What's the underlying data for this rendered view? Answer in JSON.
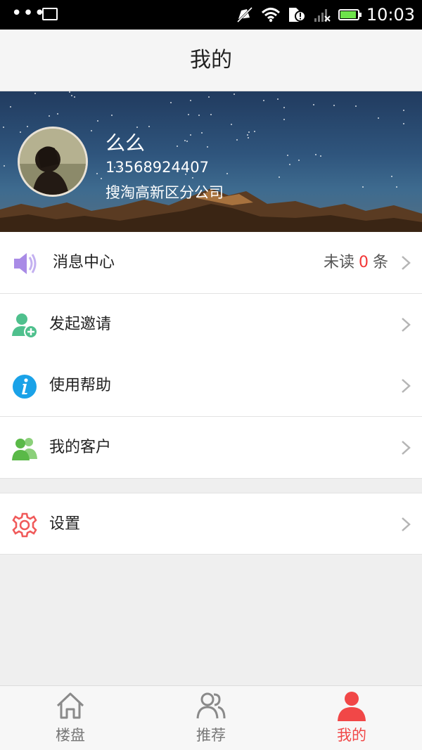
{
  "status_bar": {
    "time": "10:03",
    "battery_level": 0.9,
    "icons": [
      "more-dots-icon",
      "image-icon",
      "mute-icon",
      "wifi-icon",
      "sim-alert-icon",
      "signal-icon",
      "battery-icon"
    ]
  },
  "header": {
    "title": "我的"
  },
  "profile": {
    "name": "么么",
    "phone": "13568924407",
    "company": "搜淘高新区分公司"
  },
  "menu": {
    "messages": {
      "label": "消息中心",
      "unread_prefix": "未读",
      "unread_count": "0",
      "unread_suffix": "条",
      "icon": "speaker-icon"
    },
    "invite": {
      "label": "发起邀请",
      "icon": "add-user-icon"
    },
    "help": {
      "label": "使用帮助",
      "icon": "info-icon"
    },
    "customers": {
      "label": "我的客户",
      "icon": "users-icon"
    },
    "settings": {
      "label": "设置",
      "icon": "gear-icon"
    }
  },
  "tabs": [
    {
      "label": "楼盘",
      "icon": "home-icon",
      "active": false
    },
    {
      "label": "推荐",
      "icon": "recommend-users-icon",
      "active": false
    },
    {
      "label": "我的",
      "icon": "person-icon",
      "active": true
    }
  ],
  "colors": {
    "accent": "#f14747",
    "unread_count": "#f23535",
    "speaker": "#a98be6",
    "invite": "#4fc08d",
    "help": "#1aa2e8",
    "customers": "#5ab948",
    "settings": "#f05a5a"
  }
}
